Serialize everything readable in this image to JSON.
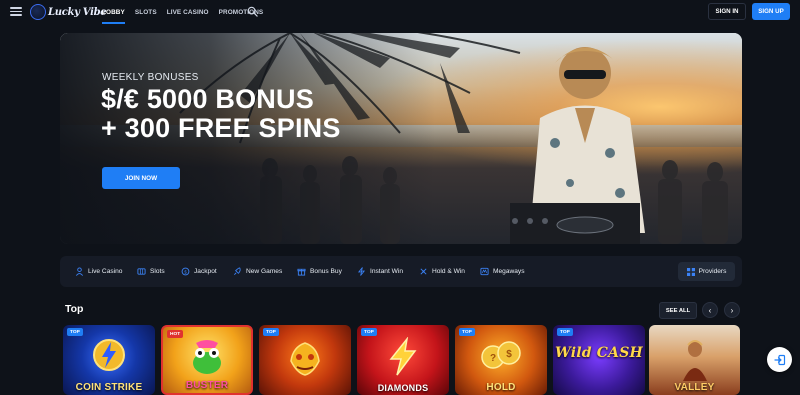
{
  "header": {
    "logo_text": "Lucky Vibe",
    "nav": [
      {
        "label": "LOBBY",
        "active": true
      },
      {
        "label": "SLOTS",
        "active": false
      },
      {
        "label": "LIVE CASINO",
        "active": false
      },
      {
        "label": "PROMOTIONS",
        "active": false
      }
    ],
    "signin_label": "SIGN IN",
    "signup_label": "SIGN UP",
    "icons": {
      "menu": "hamburger-menu-icon",
      "search": "search-icon"
    }
  },
  "hero": {
    "kicker": "WEEKLY BONUSES",
    "title_line1": "$/€ 5000 BONUS",
    "title_line2": "+ 300 FREE SPINS",
    "cta_label": "JOIN NOW"
  },
  "categories": [
    {
      "label": "Live Casino",
      "icon": "live-casino-icon"
    },
    {
      "label": "Slots",
      "icon": "slots-icon"
    },
    {
      "label": "Jackpot",
      "icon": "jackpot-icon"
    },
    {
      "label": "New Games",
      "icon": "rocket-icon"
    },
    {
      "label": "Bonus Buy",
      "icon": "gift-icon"
    },
    {
      "label": "Instant Win",
      "icon": "lightning-icon"
    },
    {
      "label": "Hold & Win",
      "icon": "hold-win-icon"
    },
    {
      "label": "Megaways",
      "icon": "megaways-icon"
    }
  ],
  "providers_label": "Providers",
  "top_section": {
    "title": "Top",
    "see_all_label": "SEE ALL",
    "prev_label": "‹",
    "next_label": "›"
  },
  "games": [
    {
      "badge": "TOP",
      "name": "COIN STRIKE",
      "badge_color": "#1f7ef5"
    },
    {
      "badge": "HOT",
      "name": "BUSTER",
      "badge_color": "#e0322f"
    },
    {
      "badge": "TOP",
      "name": "",
      "badge_color": "#1f7ef5"
    },
    {
      "badge": "TOP",
      "name": "DIAMONDS",
      "badge_color": "#1f7ef5"
    },
    {
      "badge": "TOP",
      "name": "HOLD",
      "badge_color": "#1f7ef5"
    },
    {
      "badge": "TOP",
      "name": "Wild CASH",
      "badge_color": "#1f7ef5"
    },
    {
      "badge": "",
      "name": "VALLEY",
      "badge_color": ""
    }
  ],
  "colors": {
    "accent": "#1f7ef5",
    "background": "#0e1219",
    "panel": "#161b26",
    "hot": "#e0322f"
  }
}
